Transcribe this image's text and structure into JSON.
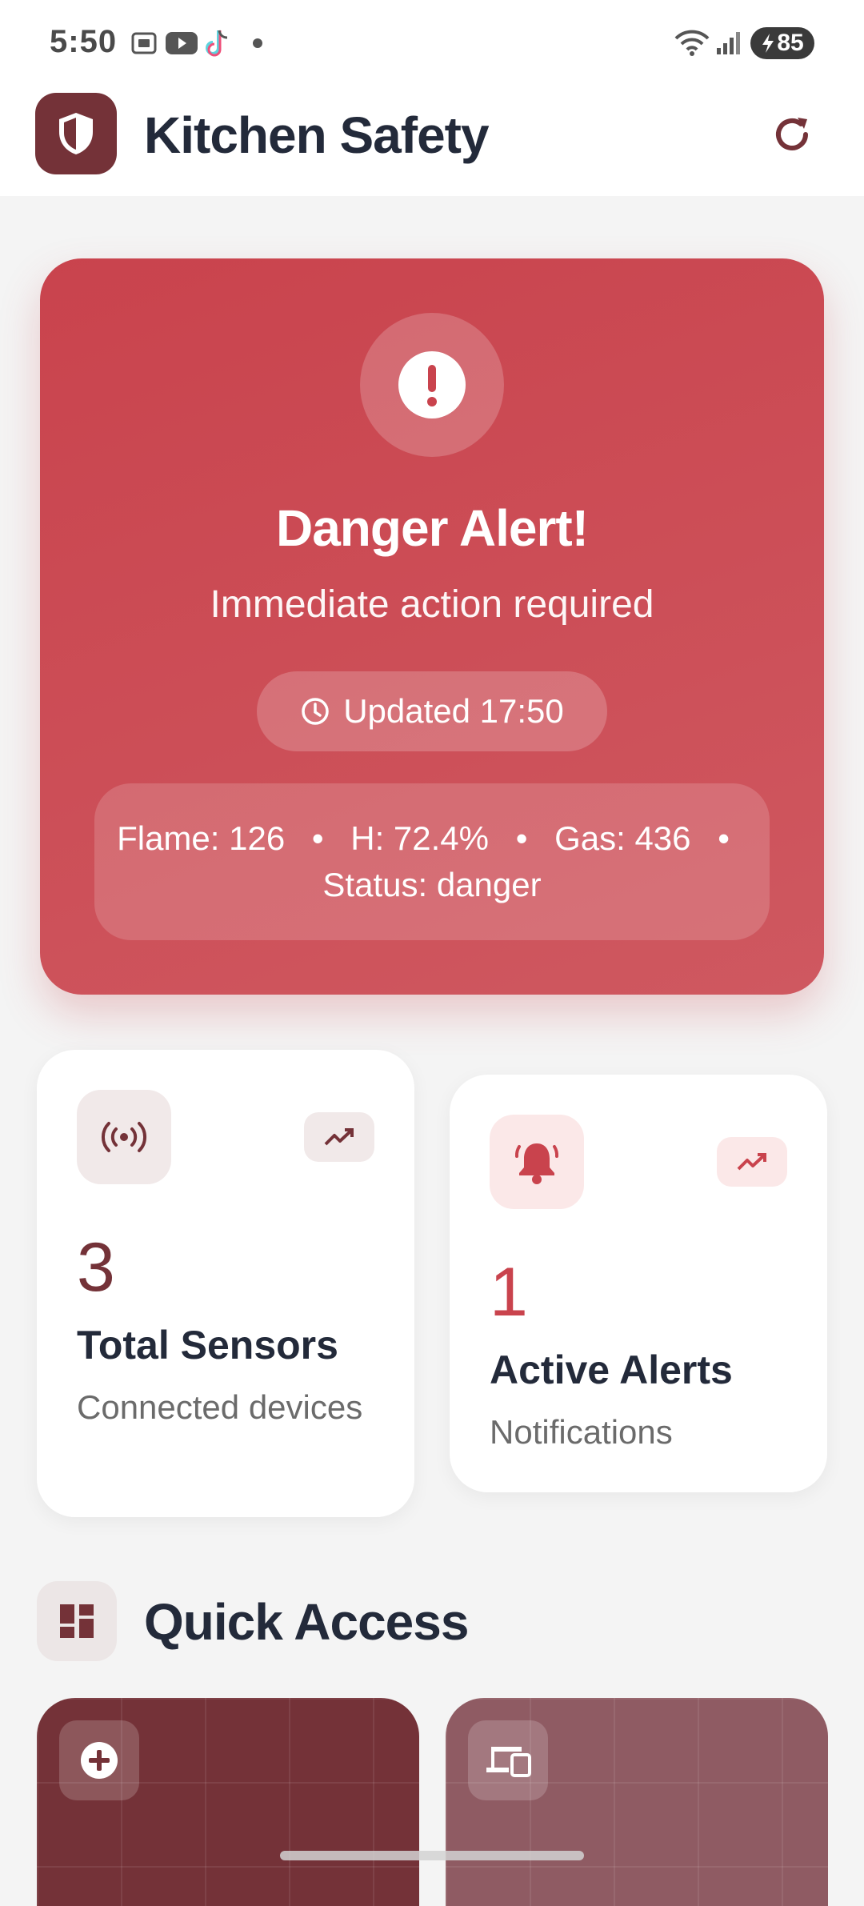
{
  "status_bar": {
    "time": "5:50",
    "battery": "85",
    "icons": [
      "screenshot-icon",
      "youtube-icon",
      "tiktok-icon",
      "notification-dot",
      "wifi-icon",
      "signal-icon",
      "battery-icon"
    ]
  },
  "header": {
    "title": "Kitchen Safety",
    "logo_icon": "shield-icon",
    "refresh_icon": "refresh-icon"
  },
  "alert": {
    "title": "Danger Alert!",
    "subtitle": "Immediate action required",
    "updated": "Updated 17:50",
    "readings": {
      "flame": "Flame: 126",
      "humidity": "H: 72.4%",
      "gas": "Gas: 436",
      "separator": "•",
      "status": "Status: danger"
    },
    "colors": {
      "card": "#c9434d",
      "text": "#ffffff"
    }
  },
  "stats": {
    "sensors": {
      "value": "3",
      "label": "Total Sensors",
      "sub": "Connected devices",
      "icon": "sensor-signal-icon",
      "trend_icon": "trending-up-icon"
    },
    "alerts": {
      "value": "1",
      "label": "Active Alerts",
      "sub": "Notifications",
      "icon": "bell-icon",
      "trend_icon": "trending-up-icon"
    }
  },
  "quick_access": {
    "title": "Quick Access",
    "icon": "dashboard-icon",
    "tiles": [
      {
        "icon": "add-circle-icon"
      },
      {
        "icon": "devices-icon"
      }
    ]
  },
  "theme": {
    "primary": "#743238",
    "danger": "#c9434d",
    "text": "#232a3a",
    "muted": "#6b6b6b",
    "background": "#f4f4f4"
  }
}
